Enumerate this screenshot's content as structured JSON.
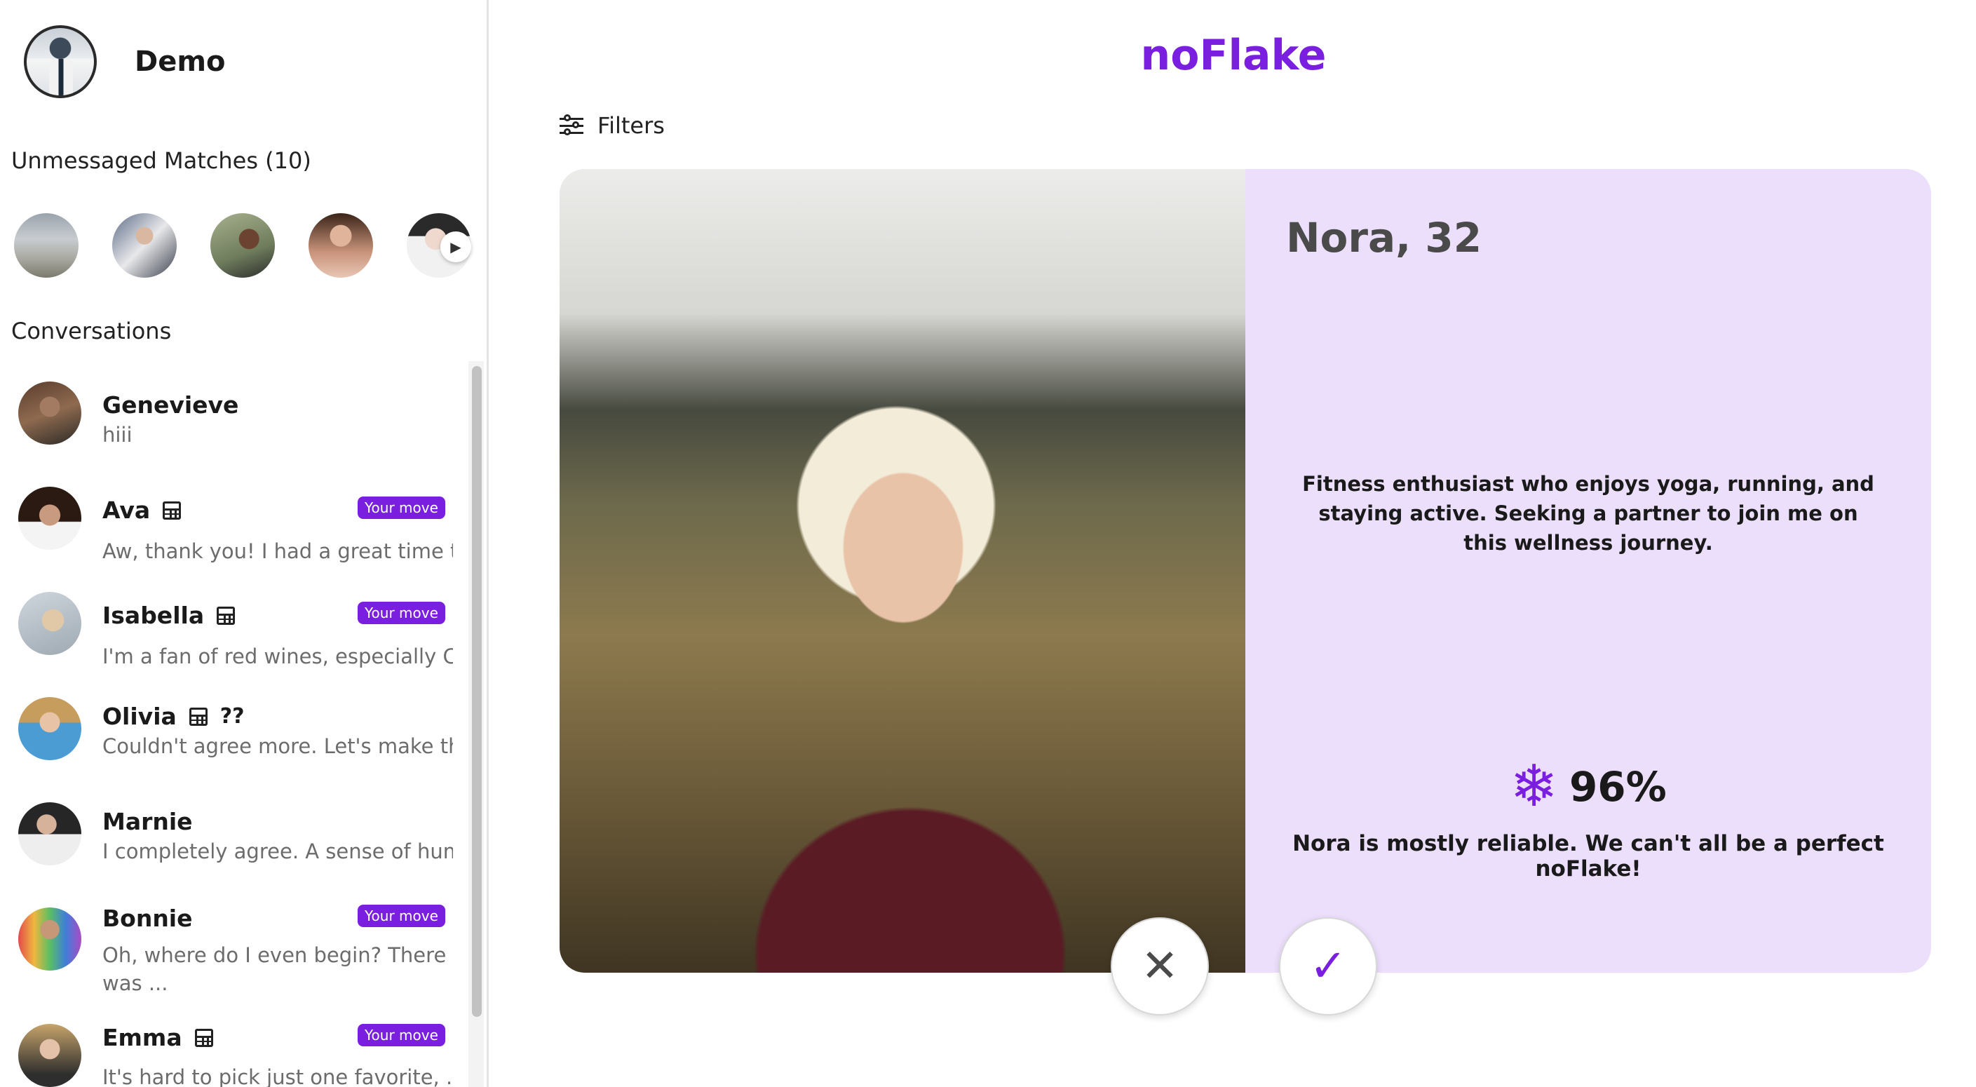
{
  "user": {
    "name": "Demo"
  },
  "unmessaged": {
    "title": "Unmessaged Matches (10)",
    "next_icon": "chevron-right-icon"
  },
  "conversations": {
    "title": "Conversations",
    "items": [
      {
        "name": "Genevieve",
        "preview": "hiii",
        "calendar": false,
        "extra": "",
        "badge": ""
      },
      {
        "name": "Ava",
        "preview": "Aw, thank you! I had a great time too...",
        "calendar": true,
        "extra": "",
        "badge": "Your move"
      },
      {
        "name": "Isabella",
        "preview": "I'm a fan of red wines, especially Ca...",
        "calendar": true,
        "extra": "",
        "badge": "Your move"
      },
      {
        "name": "Olivia",
        "preview": "Couldn't agree more. Let's make this ...",
        "calendar": true,
        "extra": "??",
        "badge": ""
      },
      {
        "name": "Marnie",
        "preview": "I completely agree. A sense of humor ...",
        "calendar": false,
        "extra": "",
        "badge": ""
      },
      {
        "name": "Bonnie",
        "preview": "Oh, where do I even begin? There was ...",
        "calendar": false,
        "extra": "",
        "badge": "Your move"
      },
      {
        "name": "Emma",
        "preview": "It's hard to pick just one favorite, ...",
        "calendar": true,
        "extra": "",
        "badge": "Your move"
      }
    ]
  },
  "main": {
    "brand": "noFlake",
    "filters_label": "Filters",
    "profile": {
      "name_age": "Nora, 32",
      "bio": "Fitness enthusiast who enjoys yoga, running, and staying active. Seeking a partner to join me on this wellness journey.",
      "score_icon": "snowflake-icon",
      "score": "96%",
      "reliability": "Nora is mostly reliable. We can't all be a perfect noFlake!"
    },
    "actions": {
      "reject_icon": "close-icon",
      "like_icon": "check-icon"
    }
  },
  "colors": {
    "accent": "#7a1fe0",
    "card_bg": "#ecdffc",
    "badge_bg": "#7a1fe0"
  }
}
